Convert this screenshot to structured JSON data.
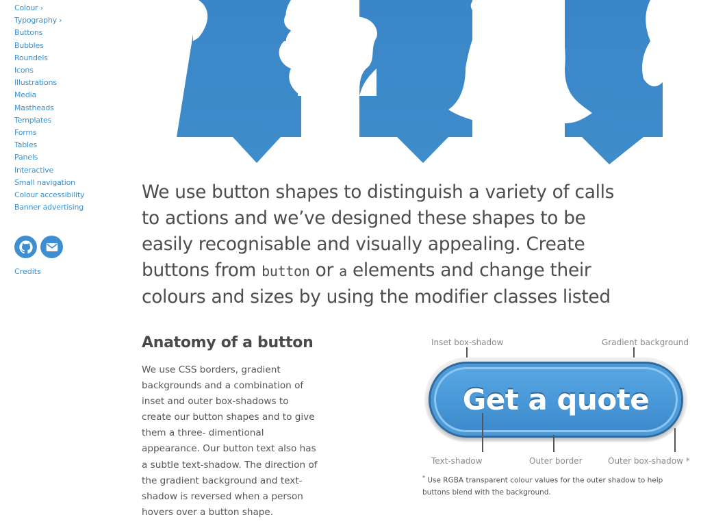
{
  "sidebar": {
    "items": [
      {
        "label": "Colour ›"
      },
      {
        "label": "Typography ›"
      },
      {
        "label": "Buttons"
      },
      {
        "label": "Bubbles"
      },
      {
        "label": "Roundels"
      },
      {
        "label": "Icons"
      },
      {
        "label": "Illustrations"
      },
      {
        "label": "Media"
      },
      {
        "label": "Mastheads"
      },
      {
        "label": "Templates"
      },
      {
        "label": "Forms"
      },
      {
        "label": "Tables"
      },
      {
        "label": "Panels"
      },
      {
        "label": "Interactive"
      },
      {
        "label": "Small navigation"
      },
      {
        "label": "Colour accessibility"
      },
      {
        "label": "Banner advertising"
      }
    ],
    "social": {
      "github_icon": "github-icon",
      "email_icon": "envelope-icon"
    },
    "credits_label": "Credits"
  },
  "colors": {
    "accent": "#3d8fd1",
    "button_dark": "#2f6b9e",
    "text": "#4d4d4d"
  },
  "intro": {
    "part1": "We use button shapes to distinguish a variety of calls to actions and we’ve designed these shapes to be easily recognisable and visually appealing. Create buttons from ",
    "code1": "button",
    "part2": " or ",
    "code2": "a",
    "part3": " elements and change their colours and sizes by using the modifier classes listed"
  },
  "anatomy": {
    "title": "Anatomy of a button",
    "body": "We use CSS borders, gradient backgrounds and a combination of inset and outer box-shadows to create our button shapes and to give them a three- dimentional appearance. Our button text also has a subtle text-shadow. The direction of the gradient background and text-shadow is reversed when a person hovers over a button shape."
  },
  "diagram": {
    "button_label": "Get a quote",
    "labels": {
      "inset_shadow": "Inset box-shadow",
      "gradient_background": "Gradient background",
      "text_shadow": "Text-shadow",
      "outer_border": "Outer border",
      "outer_shadow": "Outer box-shadow *"
    },
    "footnote_mark": "*",
    "footnote": " Use RGBA transparent colour values for the outer shadow to help buttons blend with the background."
  }
}
